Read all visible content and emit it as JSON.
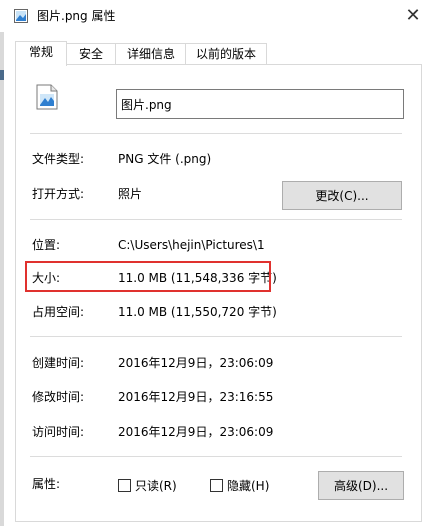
{
  "window": {
    "title": "图片.png 属性",
    "close_glyph": "✕"
  },
  "tabs": [
    {
      "label": "常规"
    },
    {
      "label": "安全"
    },
    {
      "label": "详细信息"
    },
    {
      "label": "以前的版本"
    }
  ],
  "file": {
    "name": "图片.png",
    "icon": "image-file-icon"
  },
  "type_section": {
    "file_type_label": "文件类型:",
    "file_type_value": "PNG 文件 (.png)",
    "opens_with_label": "打开方式:",
    "opens_with_value": "照片",
    "change_button": "更改(C)..."
  },
  "location_section": {
    "location_label": "位置:",
    "location_value": "C:\\Users\\hejin\\Pictures\\1",
    "size_label": "大小:",
    "size_value": "11.0 MB (11,548,336 字节)",
    "size_on_disk_label": "占用空间:",
    "size_on_disk_value": "11.0 MB (11,550,720 字节)"
  },
  "time_section": {
    "created_label": "创建时间:",
    "created_value": "2016年12月9日，23:06:09",
    "modified_label": "修改时间:",
    "modified_value": "2016年12月9日，23:16:55",
    "accessed_label": "访问时间:",
    "accessed_value": "2016年12月9日，23:06:09"
  },
  "attributes": {
    "label": "属性:",
    "readonly_label": "只读(R)",
    "hidden_label": "隐藏(H)",
    "advanced_button": "高级(D)..."
  },
  "colors": {
    "highlight": "#e0312e"
  }
}
